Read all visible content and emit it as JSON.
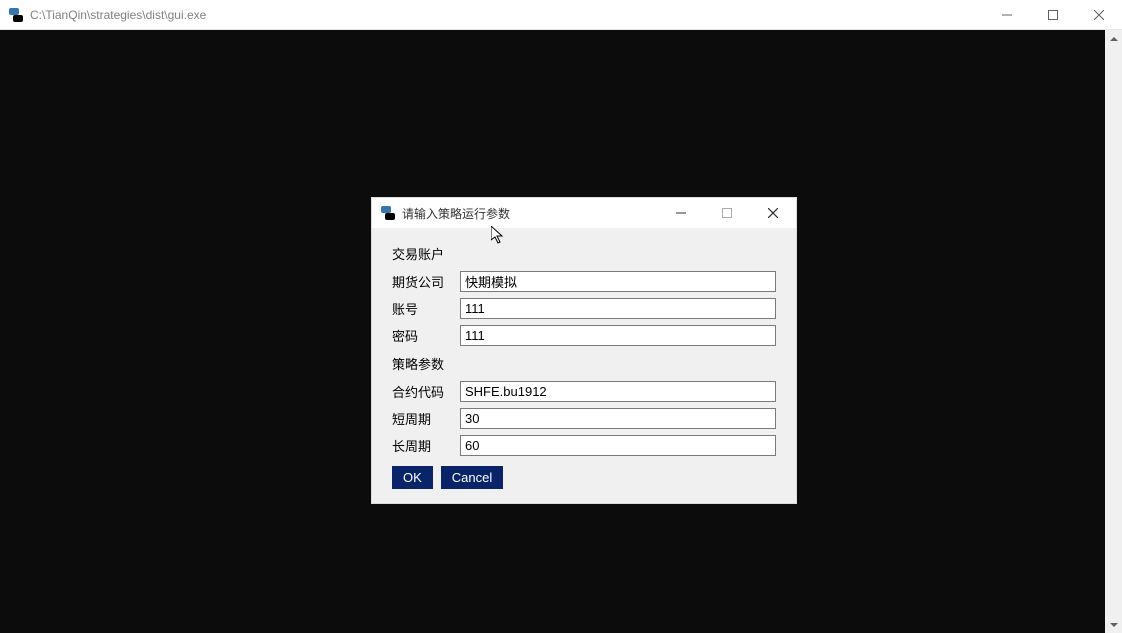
{
  "main_window": {
    "title": "C:\\TianQin\\strategies\\dist\\gui.exe"
  },
  "dialog": {
    "title": "请输入策略运行参数",
    "section1_label": "交易账户",
    "fields": {
      "broker": {
        "label": "期货公司",
        "value": "快期模拟"
      },
      "account": {
        "label": "账号",
        "value": "111"
      },
      "password": {
        "label": "密码",
        "value": "111"
      }
    },
    "section2_label": "策略参数",
    "params": {
      "symbol": {
        "label": "合约代码",
        "value": "SHFE.bu1912"
      },
      "short_period": {
        "label": "短周期",
        "value": "30"
      },
      "long_period": {
        "label": "长周期",
        "value": "60"
      }
    },
    "ok_label": "OK",
    "cancel_label": "Cancel"
  }
}
